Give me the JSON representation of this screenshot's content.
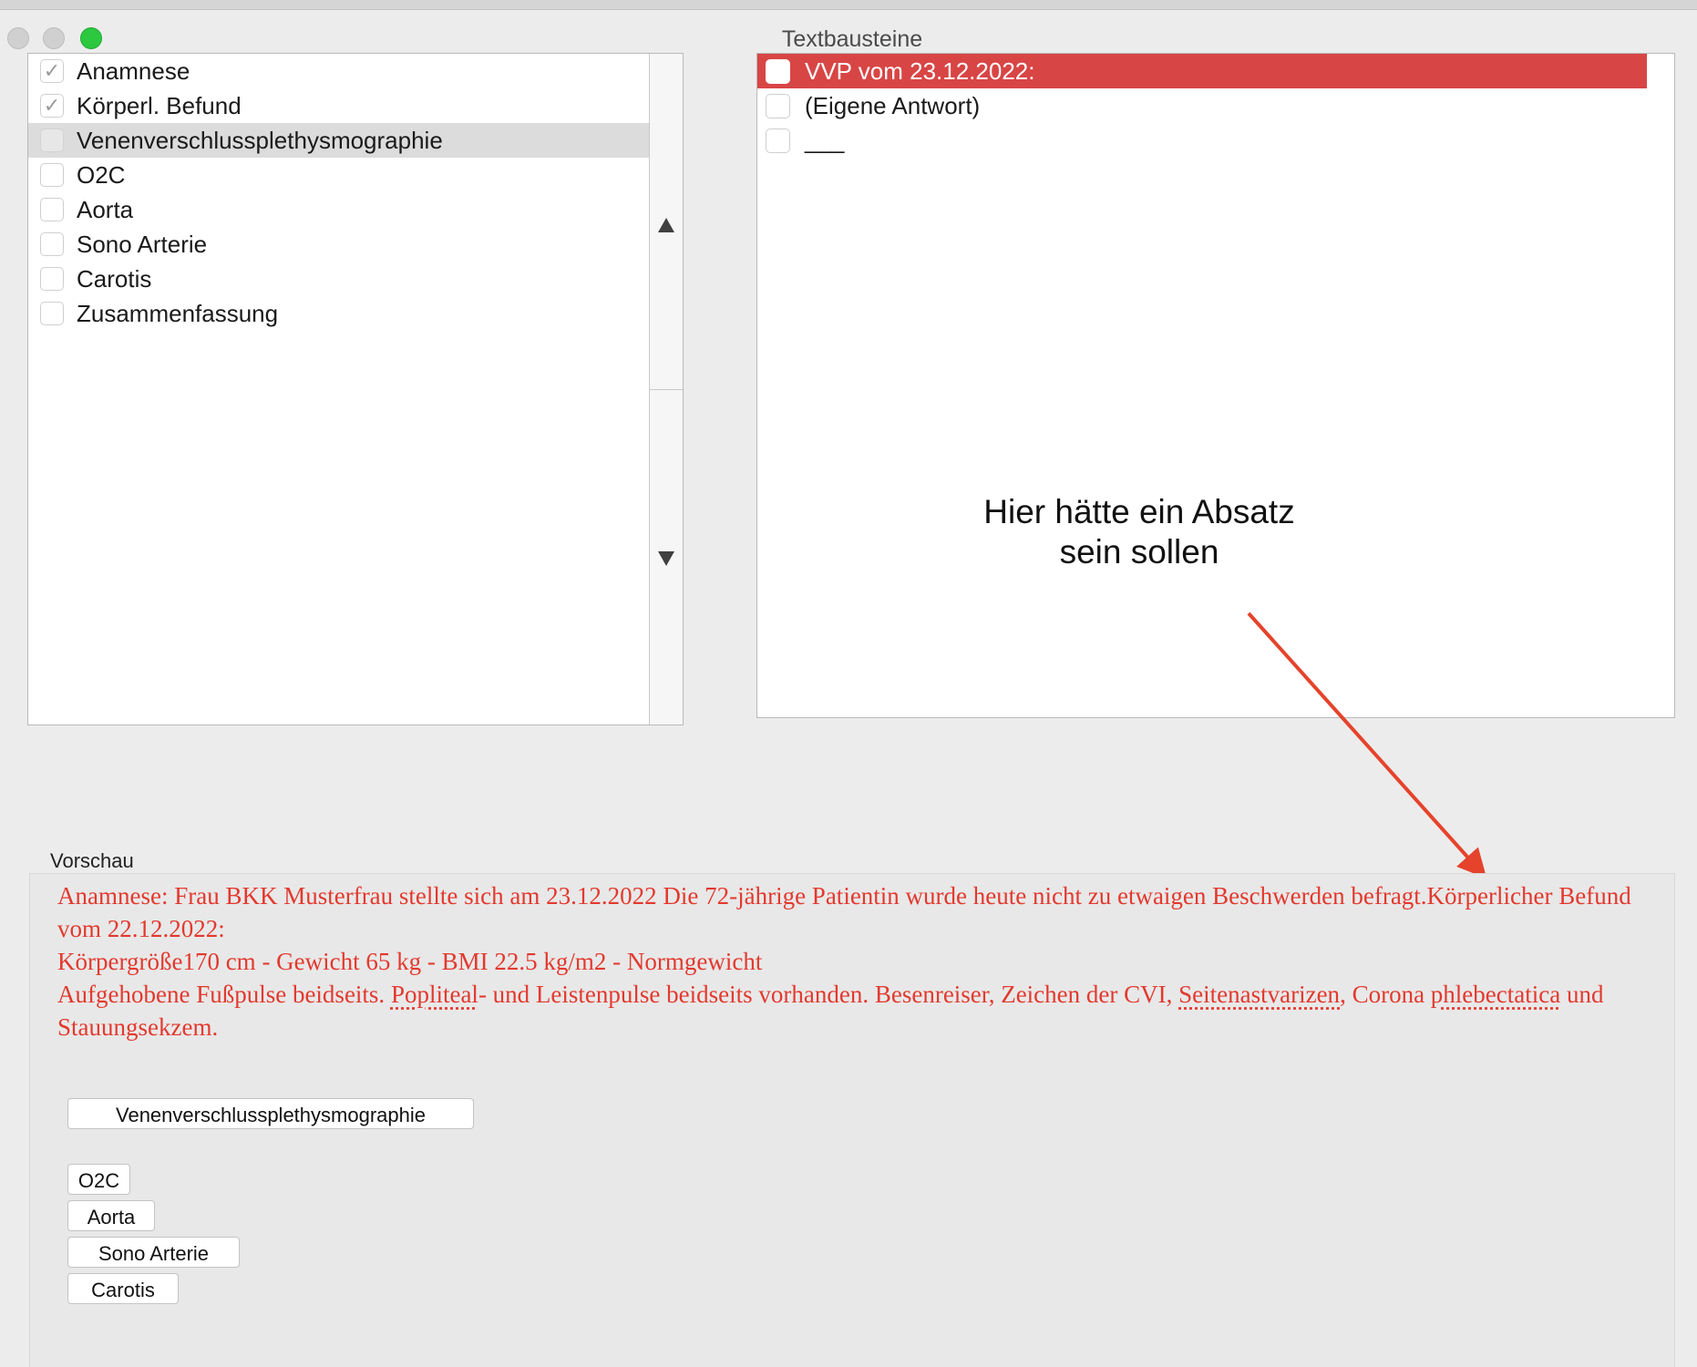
{
  "window": {
    "title": "Textbausteine"
  },
  "left_list": {
    "items": [
      {
        "label": "Anamnese",
        "checked": true
      },
      {
        "label": "Körperl. Befund",
        "checked": true
      },
      {
        "label": "Venenverschlussplethysmographie",
        "checked": false,
        "selected": true
      },
      {
        "label": "O2C",
        "checked": false
      },
      {
        "label": "Aorta",
        "checked": false
      },
      {
        "label": "Sono Arterie",
        "checked": false
      },
      {
        "label": "Carotis",
        "checked": false
      },
      {
        "label": "Zusammenfassung",
        "checked": false
      }
    ]
  },
  "right_list": {
    "items": [
      {
        "label": "VVP vom 23.12.2022:",
        "checked": false,
        "highlighted": true
      },
      {
        "label": "(Eigene Antwort)",
        "checked": false
      },
      {
        "label": "___",
        "checked": false
      }
    ]
  },
  "annotation": {
    "line1": "Hier hätte ein Absatz",
    "line2": "sein sollen"
  },
  "preview": {
    "label": "Vorschau",
    "line1": "Anamnese: Frau BKK Musterfrau stellte sich am 23.12.2022 Die 72-jährige Patientin wurde heute nicht zu etwaigen Beschwerden befragt.Körperlicher Befund vom 22.12.2022:",
    "line2": "Körpergröße170 cm - Gewicht 65 kg - BMI 22.5 kg/m2  - Normgewicht",
    "line3_a": "Aufgehobene Fußpulse beidseits. ",
    "line3_b": "Popliteal",
    "line3_c": "- und Leistenpulse beidseits vorhanden.   Besenreiser,  Zeichen der CVI,  ",
    "line3_d": "Seitenastvarizen",
    "line3_e": ",  Corona ",
    "line3_f": "phlebectatica",
    "line3_g": " und  Stauungsekzem.",
    "buttons": [
      "Venenverschlussplethysmographie",
      "O2C",
      "Aorta",
      "Sono Arterie",
      "Carotis"
    ]
  },
  "colors": {
    "accent_red": "#d84545",
    "preview_text": "#e3392e",
    "zoom_green": "#2bc840"
  }
}
